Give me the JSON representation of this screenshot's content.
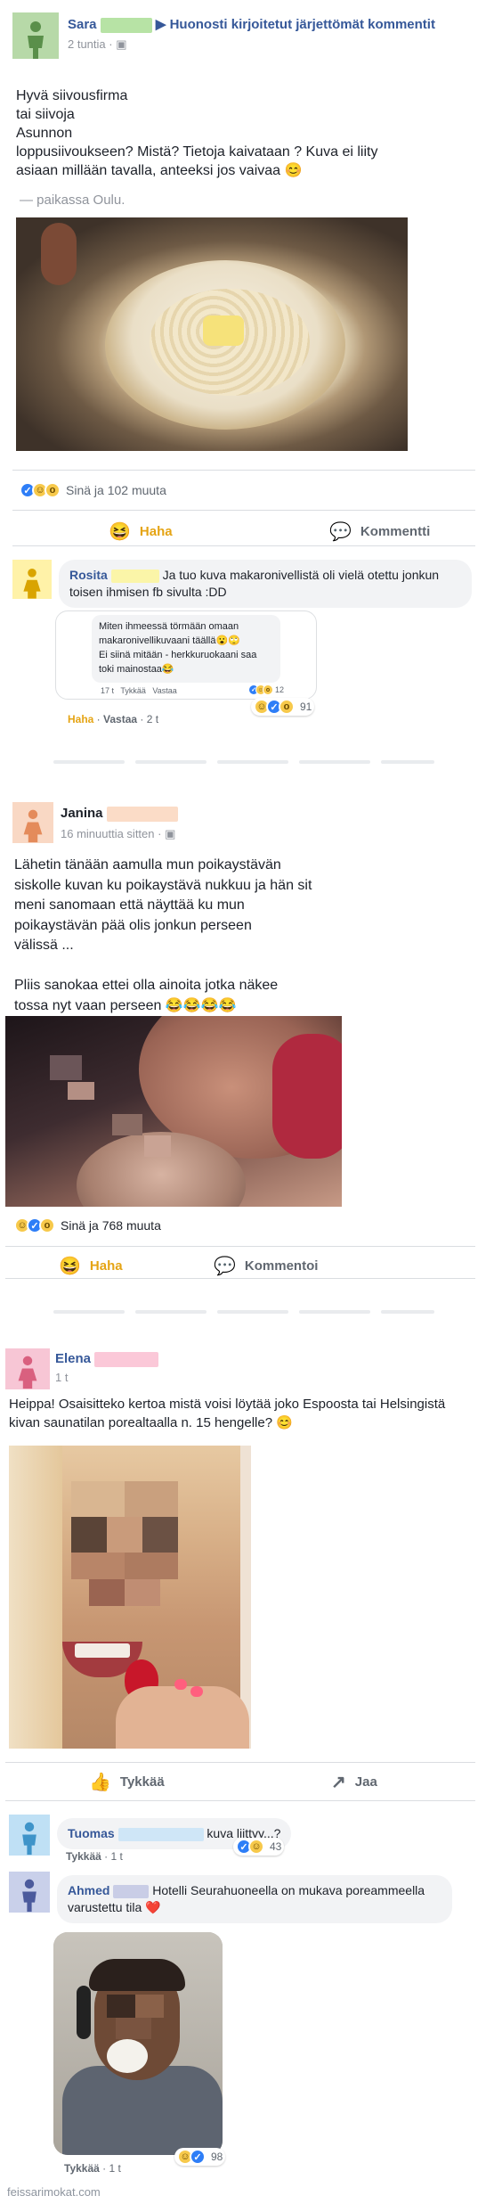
{
  "post1": {
    "author": "Sara",
    "group": "Huonosti kirjoitetut järjettömät kommentit",
    "time": "2 tuntia ·",
    "text": "Hyvä siivousfirma\ntai siivoja\nAsunnon\nloppusiivoukseen? Mistä? Tietoja kaivataan ? Kuva ei liity\nasiaan millään tavalla, anteeksi jos vaivaa 😊",
    "location": "— paikassa Oulu.",
    "reactions_text": "Sinä ja 102 muuta",
    "action_haha": "Haha",
    "action_comment": "Kommentti",
    "comment": {
      "author": "Rosita",
      "text": "Ja tuo kuva makaronivellistä oli vielä otettu jonkun toisen ihmisen fb sivulta :DD",
      "quote_text": "Miten ihmeessä törmään omaan makaronivellikuvaani täällä😮🙄\nEi siinä mitään - herkkuruokaani saa toki mainostaa😂",
      "quote_time": "17 t",
      "quote_like": "Tykkää",
      "quote_reply": "Vastaa",
      "quote_count": "12",
      "reaction_count": "91",
      "haha": "Haha",
      "reply": "Vastaa",
      "time": "2 t"
    }
  },
  "post2": {
    "author": "Janina",
    "time": "16 minuuttia sitten ·",
    "text": "Lähetin tänään aamulla mun poikaystävän\nsiskolle kuvan ku poikaystävä nukkuu ja hän sit\nmeni sanomaan että näyttää ku mun\npoikaystävän pää olis jonkun perseen\nvälissä ...\n\nPliis sanokaa ettei olla ainoita jotka näkee\ntossa nyt vaan perseen 😂😂😂😂",
    "reactions_text": "Sinä ja 768 muuta",
    "action_haha": "Haha",
    "action_comment": "Kommentoi"
  },
  "post3": {
    "author": "Elena",
    "time": "1 t",
    "text": "Heippa! Osaisitteko kertoa mistä voisi löytää joko Espoosta tai Helsingistä kivan saunatilan porealtaalla n. 15 hengelle? 😊",
    "action_like": "Tykkää",
    "action_share": "Jaa",
    "comment1": {
      "author": "Tuomas",
      "text": "kuva liittyy...?",
      "like": "Tykkää",
      "time": "1 t",
      "count": "43"
    },
    "comment2": {
      "author": "Ahmed",
      "text": "Hotelli Seurahuoneella on mukava poreammeella varustettu tila ❤️",
      "like": "Tykkää",
      "time": "1 t",
      "count": "98"
    }
  },
  "watermark": "feissarimokat.com",
  "colors": {
    "avatar_green": "#b7d9a8",
    "avatar_yellow": "#fff2a8",
    "avatar_peach": "#f9d8c4",
    "avatar_pink": "#f7c6d5",
    "avatar_blue": "#bfe0f5",
    "avatar_indigo": "#c9d0ea",
    "link_blue": "#365899"
  }
}
